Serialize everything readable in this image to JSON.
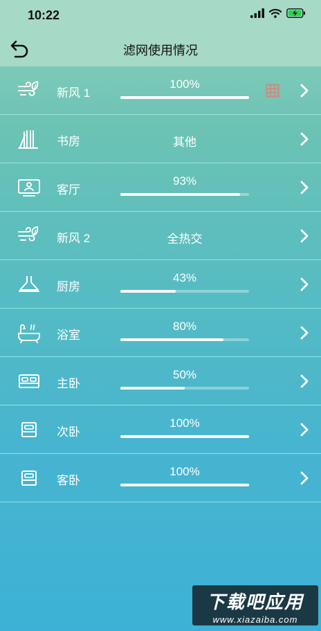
{
  "status_bar": {
    "time": "10:22"
  },
  "header": {
    "title": "滤网使用情况"
  },
  "rows": [
    {
      "name": "新风 1",
      "icon": "fresh-air-icon",
      "percent_label": "100%",
      "percent": 100
    },
    {
      "name": "书房",
      "icon": "books-icon",
      "status_text": "其他"
    },
    {
      "name": "客厅",
      "icon": "tv-icon",
      "percent_label": "93%",
      "percent": 93
    },
    {
      "name": "新风 2",
      "icon": "fresh-air-icon",
      "status_text": "全热交"
    },
    {
      "name": "厨房",
      "icon": "range-hood-icon",
      "percent_label": "43%",
      "percent": 43
    },
    {
      "name": "浴室",
      "icon": "bathtub-icon",
      "percent_label": "80%",
      "percent": 80
    },
    {
      "name": "主卧",
      "icon": "double-bed-icon",
      "percent_label": "50%",
      "percent": 50
    },
    {
      "name": "次卧",
      "icon": "single-bed-icon",
      "percent_label": "100%",
      "percent": 100
    },
    {
      "name": "客卧",
      "icon": "single-bed-icon",
      "percent_label": "100%",
      "percent": 100
    }
  ],
  "watermark": {
    "title": "下载吧应用",
    "url": "www.xiazaiba.com"
  },
  "colors": {
    "extra_icon": "#c98c7e",
    "divider": "#aaf5eb"
  }
}
